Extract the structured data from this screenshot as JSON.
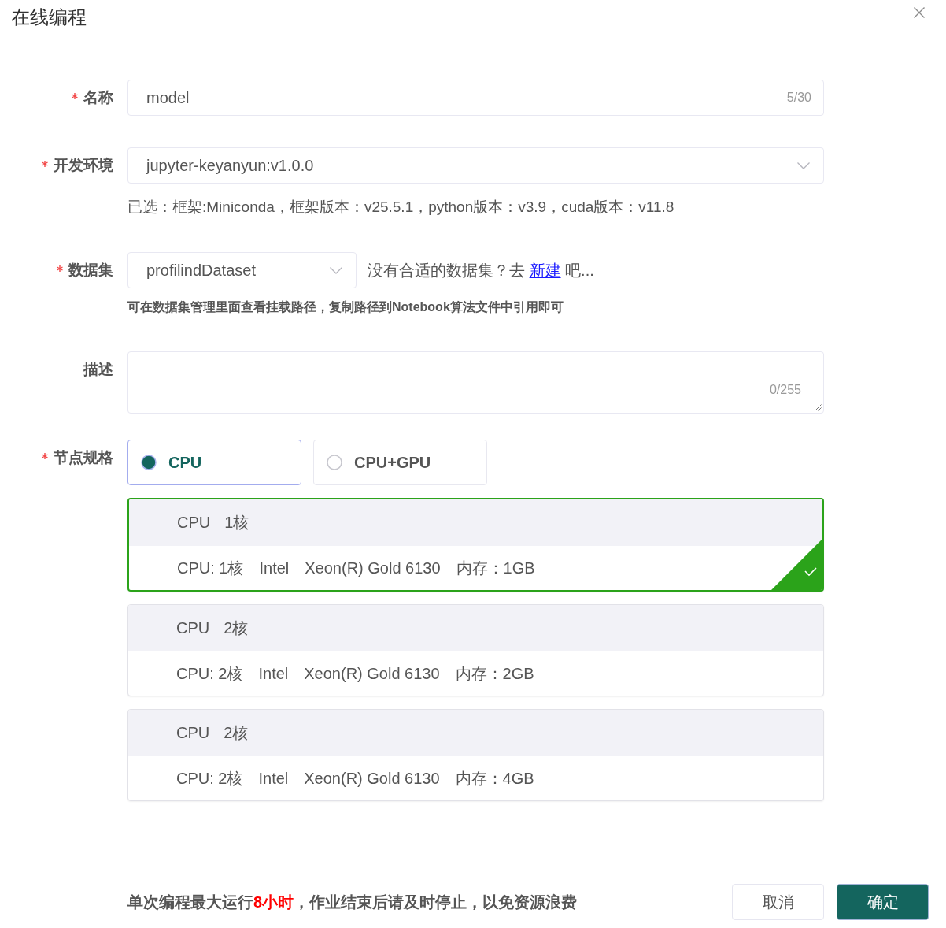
{
  "dialog": {
    "title": "在线编程"
  },
  "name_field": {
    "label": "名称",
    "required": true,
    "value": "model",
    "counter": "5/30"
  },
  "environment_field": {
    "label": "开发环境",
    "required": true,
    "value": "jupyter-keyanyun:v1.0.0",
    "note": "已选：框架:Miniconda，框架版本：v25.5.1，python版本：v3.9，cuda版本：v11.8"
  },
  "dataset_field": {
    "label": "数据集",
    "required": true,
    "value": "profilindDataset",
    "prompt": "没有合适的数据集？去",
    "link": "新建",
    "prompt_end": "吧...",
    "note": "可在数据集管理里面查看挂载路径，复制路径到Notebook算法文件中引用即可"
  },
  "description_field": {
    "label": "描述",
    "required": false,
    "counter": "0/255"
  },
  "node_spec": {
    "label": "节点规格",
    "required": true,
    "options": [
      {
        "label": "CPU",
        "selected": true
      },
      {
        "label": "CPU+GPU",
        "selected": false
      }
    ],
    "specs": [
      {
        "header": [
          "CPU",
          "1核"
        ],
        "details": [
          "CPU: 1核",
          "Intel",
          "Xeon(R) Gold 6130",
          "内存：1GB"
        ],
        "selected": true
      },
      {
        "header": [
          "CPU",
          "2核"
        ],
        "details": [
          "CPU: 2核",
          "Intel",
          "Xeon(R) Gold 6130",
          "内存：2GB"
        ],
        "selected": false
      },
      {
        "header": [
          "CPU",
          "2核"
        ],
        "details": [
          "CPU: 2核",
          "Intel",
          "Xeon(R) Gold 6130",
          "内存：4GB"
        ],
        "selected": false
      }
    ]
  },
  "footer": {
    "notice": "单次编程最大运行**8小时**，作业结束后请及时停止，以免资源浪费",
    "buttons": [
      {
        "label": "取消",
        "kind": "secondary"
      },
      {
        "label": "确定",
        "kind": "primary"
      }
    ]
  }
}
